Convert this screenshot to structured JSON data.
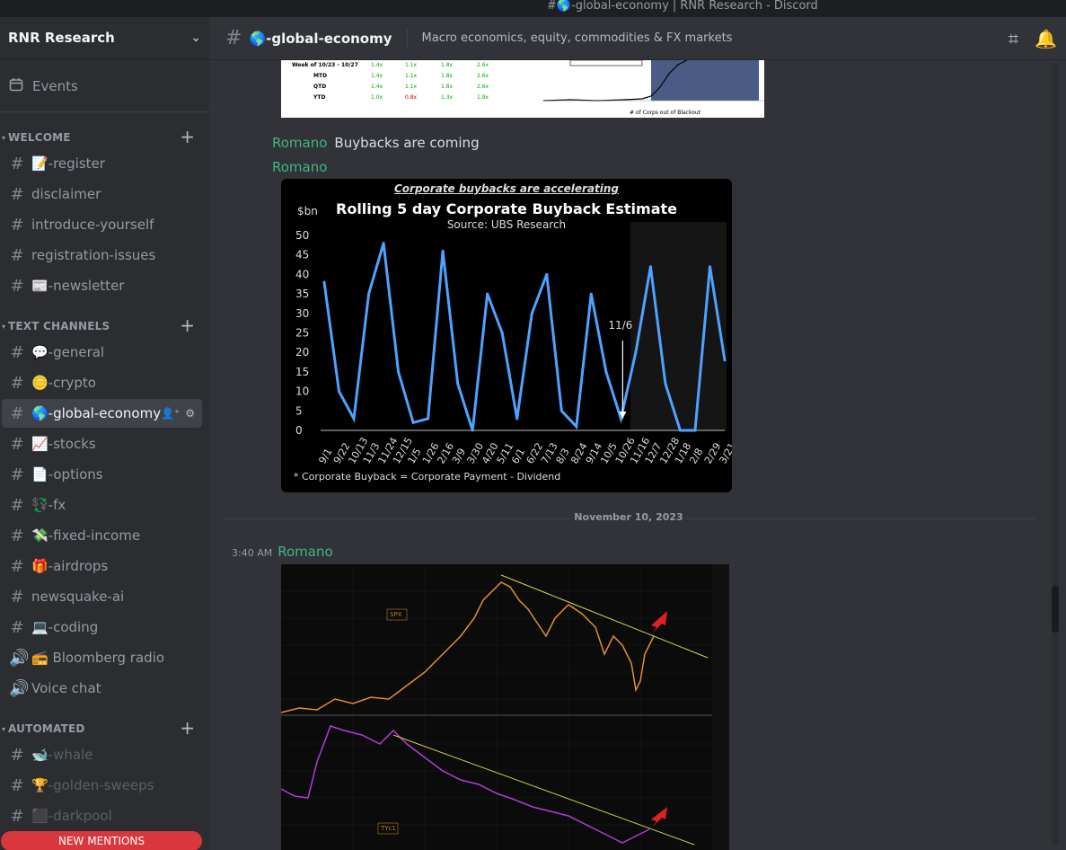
{
  "window": {
    "title": "#🌎-global-economy | RNR Research - Discord"
  },
  "server": {
    "name": "RNR Research"
  },
  "events_label": "Events",
  "categories": {
    "welcome": "WELCOME",
    "text": "TEXT CHANNELS",
    "automated": "AUTOMATED"
  },
  "channels": [
    {
      "label": "📝-register"
    },
    {
      "label": "disclaimer"
    },
    {
      "label": "introduce-yourself"
    },
    {
      "label": "registration-issues"
    },
    {
      "label": "📰-newsletter"
    },
    {
      "label": "💬-general"
    },
    {
      "label": "🪙-crypto"
    },
    {
      "label": "🌎-global-economy"
    },
    {
      "label": "📈-stocks"
    },
    {
      "label": "📄-options"
    },
    {
      "label": "💱-fx"
    },
    {
      "label": "💸-fixed-income"
    },
    {
      "label": "🎁-airdrops"
    },
    {
      "label": "newsquake-ai"
    },
    {
      "label": "💻-coding"
    },
    {
      "label": "📻 Bloomberg radio"
    },
    {
      "label": "Voice chat"
    },
    {
      "label": "🐋-whale"
    },
    {
      "label": "🏆-golden-sweeps"
    },
    {
      "label": "⬛-darkpool"
    }
  ],
  "new_mentions": "NEW MENTIONS",
  "header": {
    "channel": "🌎-global-economy",
    "topic": "Macro economics, equity, commodities & FX markets"
  },
  "messages": [
    {
      "author": "Romano",
      "text": "Buybacks are coming"
    },
    {
      "author": "Romano",
      "text": ""
    },
    {
      "author": "Romano",
      "time": "3:40 AM",
      "text": ""
    }
  ],
  "date_divider": "November 10, 2023",
  "top_table": {
    "rows": [
      {
        "label": "Week of 10/23 - 10/27",
        "v": [
          "1.4x",
          "1.1x",
          "1.8x",
          "2.6x"
        ]
      },
      {
        "label": "MTD",
        "v": [
          "1.4x",
          "1.1x",
          "1.8x",
          "2.6x"
        ]
      },
      {
        "label": "QTD",
        "v": [
          "1.4x",
          "1.1x",
          "1.8x",
          "2.6x"
        ]
      },
      {
        "label": "YTD",
        "v": [
          "1.0x",
          "0.8x",
          "1.3x",
          "1.9x"
        ]
      }
    ]
  },
  "top_chart_caption": "# of Corps out of Blackout",
  "buyback_chart": {
    "banner": "Corporate buybacks are accelerating",
    "title": "Rolling 5 day Corporate Buyback Estimate",
    "source": "Source: UBS Research",
    "unit": "$bn",
    "annotation": "11/6",
    "footnote": "* Corporate Buyback = Corporate Payment - Dividend"
  },
  "spx_chart": {
    "label_top": "SPX",
    "label_bottom": "TYc1"
  },
  "colors": {
    "author": "#43b581",
    "line": "#4da3ff",
    "accent": "#da373c"
  },
  "chart_data": {
    "type": "line",
    "title": "Rolling 5 day Corporate Buyback Estimate",
    "ylabel": "$bn",
    "ylim": [
      0,
      50
    ],
    "yticks": [
      0,
      5,
      10,
      15,
      20,
      25,
      30,
      35,
      40,
      45,
      50
    ],
    "categories": [
      "9/1",
      "9/22",
      "10/13",
      "11/3",
      "11/24",
      "12/15",
      "1/5",
      "1/26",
      "2/16",
      "3/9",
      "3/30",
      "4/20",
      "5/11",
      "6/1",
      "6/22",
      "7/13",
      "8/3",
      "8/24",
      "9/14",
      "10/5",
      "10/26",
      "11/16",
      "12/7",
      "12/28",
      "1/18",
      "2/8",
      "2/29",
      "3/21"
    ],
    "series": [
      {
        "values": [
          38,
          10,
          3,
          35,
          48,
          15,
          2,
          3,
          46,
          12,
          0,
          35,
          25,
          3,
          30,
          40,
          5,
          1,
          35,
          15,
          3,
          20,
          42,
          12,
          0,
          0,
          42,
          18
        ]
      }
    ]
  }
}
